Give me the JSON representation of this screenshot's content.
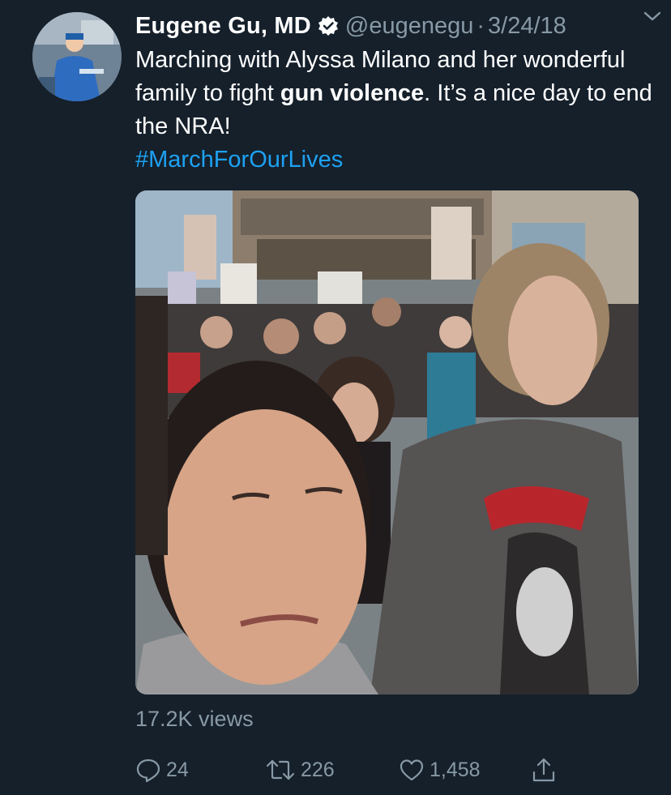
{
  "tweet": {
    "author_name": "Eugene Gu, MD",
    "handle": "@eugenegu",
    "separator": "·",
    "date": "3/24/18",
    "text_part1": "Marching with Alyssa Milano and her wonderful family to fight ",
    "text_bold": "gun violence",
    "text_part2": ". It’s a nice day to end the NRA!",
    "hashtag": "#MarchForOurLives",
    "views": "17.2K views"
  },
  "actions": {
    "reply_count": "24",
    "retweet_count": "226",
    "like_count": "1,458"
  },
  "colors": {
    "background": "#15202b",
    "text": "#ffffff",
    "secondary": "#8899a6",
    "link": "#1da1f2",
    "verified": "#ffffff"
  },
  "icons": {
    "verified": "verified-badge-icon",
    "caret": "chevron-down-icon",
    "reply": "reply-icon",
    "retweet": "retweet-icon",
    "like": "heart-icon",
    "share": "share-icon"
  }
}
